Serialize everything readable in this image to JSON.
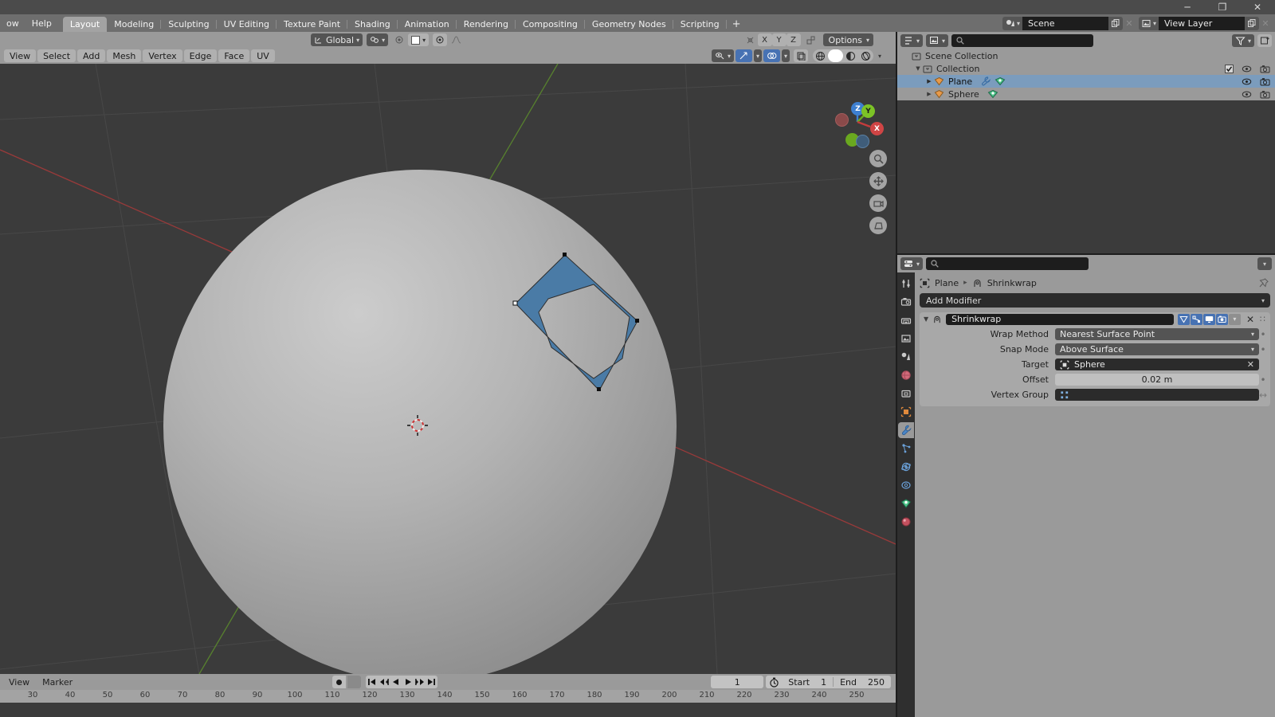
{
  "window": {
    "controls": {
      "minimize": "─",
      "maximize": "❐",
      "close": "✕"
    }
  },
  "topbar": {
    "menus": [
      "ow",
      "Help"
    ],
    "workspaces": [
      {
        "label": "Layout",
        "active": true
      },
      {
        "label": "Modeling",
        "active": false
      },
      {
        "label": "Sculpting",
        "active": false
      },
      {
        "label": "UV Editing",
        "active": false
      },
      {
        "label": "Texture Paint",
        "active": false
      },
      {
        "label": "Shading",
        "active": false
      },
      {
        "label": "Animation",
        "active": false
      },
      {
        "label": "Rendering",
        "active": false
      },
      {
        "label": "Compositing",
        "active": false
      },
      {
        "label": "Geometry Nodes",
        "active": false
      },
      {
        "label": "Scripting",
        "active": false
      }
    ],
    "add_workspace": "+",
    "scene": {
      "name": "Scene",
      "icon": "scene-icon"
    },
    "view_layer": {
      "name": "View Layer",
      "icon": "view-layer-icon"
    }
  },
  "viewport": {
    "header": {
      "transform_orientation": "Global",
      "snap_axes": [
        "X",
        "Y",
        "Z"
      ],
      "options_label": "Options",
      "mode_icon": "edit-mode-icon"
    },
    "menus": [
      "View",
      "Select",
      "Add",
      "Mesh",
      "Vertex",
      "Edge",
      "Face",
      "UV"
    ],
    "gizmo": {
      "axis_z": "Z",
      "axis_y": "Y",
      "axis_x": "X"
    },
    "shading_modes": [
      "wireframe",
      "solid",
      "material",
      "rendered"
    ],
    "active_shading": "solid",
    "nav_buttons": [
      "zoom-icon",
      "pan-icon",
      "camera-icon",
      "ortho-persp-icon"
    ],
    "colors": {
      "background": "#3b3b3b",
      "selected_face": "#4a7ba6",
      "object_gray": "#a5a5a5",
      "axis_x": "#a33b3b",
      "axis_y": "#5b8a2e"
    }
  },
  "outliner": {
    "search_placeholder": "",
    "rows": [
      {
        "label": "Scene Collection",
        "depth": 0,
        "icon": "collection-icon",
        "selected": false,
        "expander": "",
        "has_vis": false
      },
      {
        "label": "Collection",
        "depth": 1,
        "icon": "collection-icon",
        "selected": false,
        "expander": "▼",
        "has_vis": true,
        "has_check": true
      },
      {
        "label": "Plane",
        "depth": 2,
        "icon": "mesh-object-icon",
        "selected": true,
        "expander": "▶",
        "has_vis": true,
        "extra_icons": [
          "modifier-wrench-icon",
          "mesh-data-icon"
        ]
      },
      {
        "label": "Sphere",
        "depth": 2,
        "icon": "mesh-object-icon",
        "selected": false,
        "expander": "▶",
        "has_vis": true,
        "extra_icons": [
          "mesh-data-icon"
        ]
      }
    ]
  },
  "properties": {
    "breadcrumb": {
      "object": "Plane",
      "modifier": "Shrinkwrap",
      "separator": "▸"
    },
    "add_modifier_label": "Add Modifier",
    "tabs": [
      {
        "name": "tool",
        "icon": "tool-icon",
        "active": false
      },
      {
        "name": "render",
        "icon": "render-camera-icon",
        "active": false
      },
      {
        "name": "output",
        "icon": "output-printer-icon",
        "active": false
      },
      {
        "name": "view-layer",
        "icon": "view-layer-images-icon",
        "active": false
      },
      {
        "name": "scene",
        "icon": "scene-cone-icon",
        "active": false
      },
      {
        "name": "world",
        "icon": "world-globe-icon",
        "active": false
      },
      {
        "name": "collection",
        "icon": "collection-box-icon",
        "active": false
      },
      {
        "name": "object",
        "icon": "object-square-icon",
        "active": false
      },
      {
        "name": "modifiers",
        "icon": "wrench-icon",
        "active": true
      },
      {
        "name": "particles",
        "icon": "particles-icon",
        "active": false
      },
      {
        "name": "physics",
        "icon": "physics-orbit-icon",
        "active": false
      },
      {
        "name": "constraints",
        "icon": "constraints-icon",
        "active": false
      },
      {
        "name": "data",
        "icon": "mesh-data-triangle-icon",
        "active": false
      },
      {
        "name": "material",
        "icon": "material-sphere-icon",
        "active": false
      }
    ],
    "modifier": {
      "name": "Shrinkwrap",
      "expander": "▼",
      "icon": "shrinkwrap-icon",
      "display_toggles": [
        "edit-mode-cage-icon",
        "edit-mode-icon",
        "realtime-display-icon",
        "render-display-icon"
      ],
      "extras_chevron": "⌄",
      "close": "✕",
      "grip": "∷",
      "fields": [
        {
          "label": "Wrap Method",
          "value": "Nearest Surface Point",
          "type": "dropdown",
          "animatable": true
        },
        {
          "label": "Snap Mode",
          "value": "Above Surface",
          "type": "dropdown",
          "animatable": true
        },
        {
          "label": "Target",
          "value": "Sphere",
          "type": "object-pointer",
          "icon": "object-square-icon",
          "clearable": true
        },
        {
          "label": "Offset",
          "value": "0.02 m",
          "type": "number",
          "animatable": true
        },
        {
          "label": "Vertex Group",
          "value": "",
          "type": "vertex-group",
          "icon": "vertex-group-icon"
        }
      ]
    }
  },
  "timeline": {
    "menus": [
      "View",
      "Marker"
    ],
    "playback_buttons": [
      "jump-start-icon",
      "prev-keyframe-icon",
      "play-reverse-icon",
      "play-icon",
      "next-keyframe-icon",
      "jump-end-icon"
    ],
    "record_icon": "auto-keying-icon",
    "current_frame": "1",
    "frame_icon": "stopwatch-icon",
    "start_label": "Start",
    "start_value": "1",
    "end_label": "End",
    "end_value": "250",
    "ruler_ticks": [
      "30",
      "40",
      "50",
      "60",
      "70",
      "80",
      "90",
      "100",
      "110",
      "120",
      "130",
      "140",
      "150",
      "160",
      "170",
      "180",
      "190",
      "200",
      "210",
      "220",
      "230",
      "240",
      "250"
    ]
  }
}
